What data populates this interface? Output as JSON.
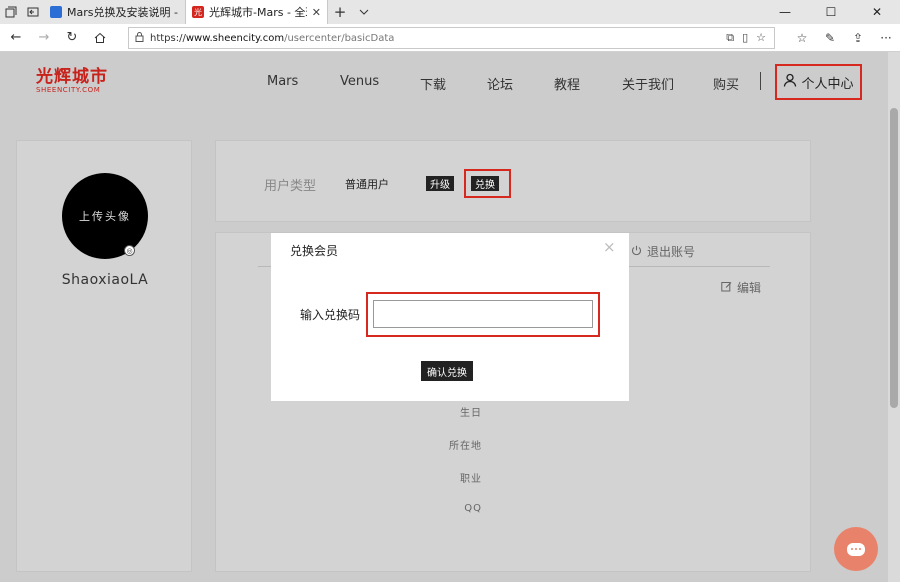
{
  "browser": {
    "tabs": [
      {
        "title": "Mars兑换及安装说明 - 金山"
      },
      {
        "title": "光辉城市-Mars - 全球领"
      }
    ],
    "address": {
      "scheme": "https://",
      "host": "www.sheencity.com",
      "path": "/usercenter/basicData"
    }
  },
  "site": {
    "logo": {
      "cn": "光辉城市",
      "en": "SHEENCITY.COM"
    },
    "menu": [
      "Mars",
      "Venus",
      "下载",
      "论坛",
      "教程",
      "关于我们",
      "购买"
    ],
    "separator": "|",
    "user_center": "个人中心"
  },
  "profile": {
    "avatar_text": "上传头像",
    "username": "ShaoxiaoLA"
  },
  "membership": {
    "label": "用户类型",
    "value": "普通用户",
    "upgrade": "升级",
    "exchange": "兑换"
  },
  "info": {
    "logout": "退出账号",
    "edit": "编辑",
    "fields": [
      "生日",
      "所在地",
      "职业",
      "QQ"
    ]
  },
  "modal": {
    "title": "兑换会员",
    "close": "×",
    "code_label": "输入兑换码",
    "code_value": "",
    "confirm": "确认兑换"
  },
  "icons": {
    "tab_actions": "tab-actions-icon",
    "user": "user-icon",
    "power": "power-icon",
    "edit": "edit-icon",
    "chat": "chat-icon"
  },
  "colors": {
    "brand_red": "#c8221c",
    "highlight_red": "#d6281e",
    "chat": "#e8826a"
  }
}
